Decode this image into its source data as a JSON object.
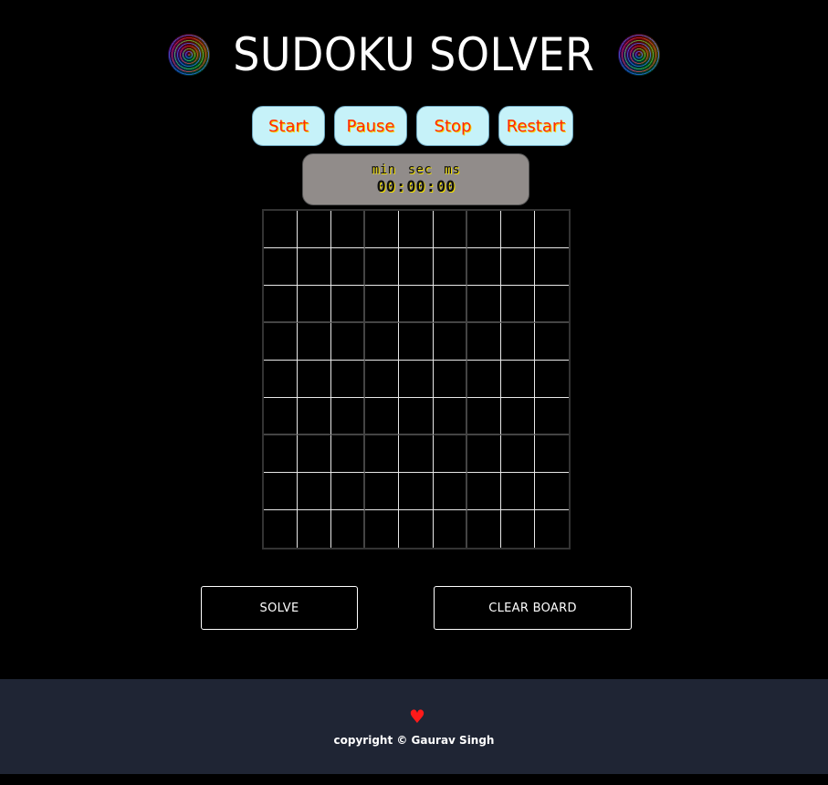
{
  "header": {
    "title": "SUDOKU SOLVER",
    "left_icon": "spiral-icon",
    "right_icon": "spiral-icon"
  },
  "timer_controls": {
    "start_label": "Start",
    "pause_label": "Pause",
    "stop_label": "Stop",
    "restart_label": "Restart"
  },
  "stopwatch": {
    "unit_min": "min",
    "unit_sec": "sec",
    "unit_ms": "ms",
    "min": "00",
    "sec": "00",
    "ms": "00",
    "separator": ":"
  },
  "board": {
    "rows": 9,
    "cols": 9,
    "cells": [
      [
        "",
        "",
        "",
        "",
        "",
        "",
        "",
        "",
        ""
      ],
      [
        "",
        "",
        "",
        "",
        "",
        "",
        "",
        "",
        ""
      ],
      [
        "",
        "",
        "",
        "",
        "",
        "",
        "",
        "",
        ""
      ],
      [
        "",
        "",
        "",
        "",
        "",
        "",
        "",
        "",
        ""
      ],
      [
        "",
        "",
        "",
        "",
        "",
        "",
        "",
        "",
        ""
      ],
      [
        "",
        "",
        "",
        "",
        "",
        "",
        "",
        "",
        ""
      ],
      [
        "",
        "",
        "",
        "",
        "",
        "",
        "",
        "",
        ""
      ],
      [
        "",
        "",
        "",
        "",
        "",
        "",
        "",
        "",
        ""
      ],
      [
        "",
        "",
        "",
        "",
        "",
        "",
        "",
        "",
        ""
      ]
    ]
  },
  "actions": {
    "solve_label": "SOLVE",
    "clear_label": "CLEAR BOARD"
  },
  "footer": {
    "heart_icon": "heart-icon",
    "heart_glyph": "♥",
    "copyright": "copyright © Gaurav Singh"
  },
  "colors": {
    "background": "#000000",
    "footer_bg": "#1f2534",
    "timer_button_bg": "#c6f2f9",
    "timer_button_text": "#ff2a00",
    "stopwatch_bg": "#918c8a",
    "heart": "#ff1a1a"
  }
}
